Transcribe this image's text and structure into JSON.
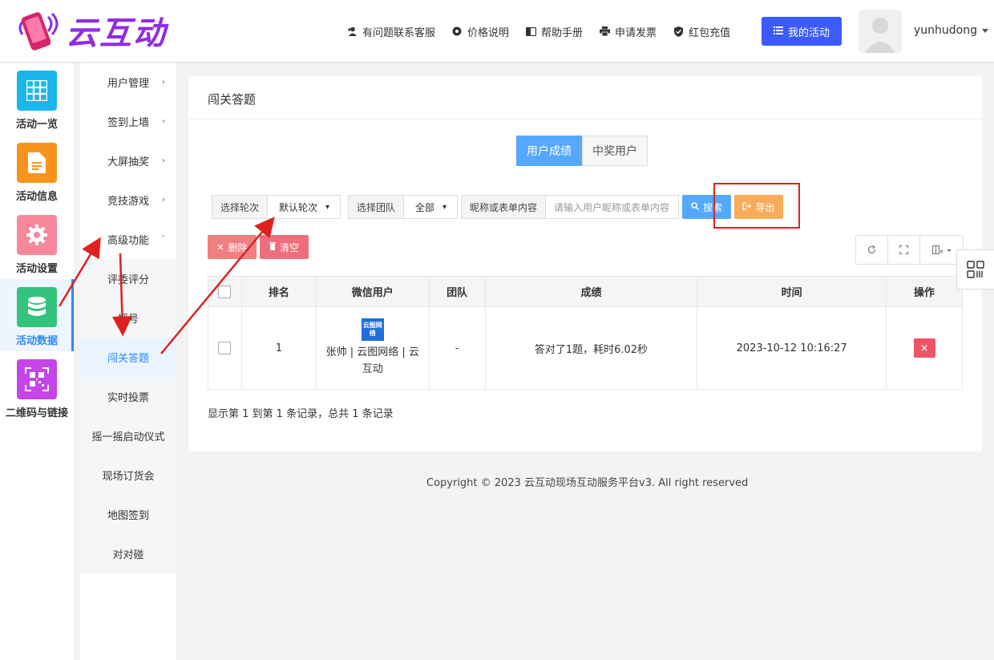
{
  "brand": {
    "name": "云互动"
  },
  "header": {
    "nav": [
      {
        "label": "有问题联系客服",
        "icon": "user-plus-icon"
      },
      {
        "label": "价格说明",
        "icon": "gear-icon"
      },
      {
        "label": "帮助手册",
        "icon": "book-icon"
      },
      {
        "label": "申请发票",
        "icon": "printer-icon"
      },
      {
        "label": "红包充值",
        "icon": "shield-check-icon"
      }
    ],
    "my_activity": "我的活动",
    "username": "yunhudong"
  },
  "rail": [
    {
      "label": "活动一览",
      "icon": "grid-icon",
      "color": "#1ab7ea"
    },
    {
      "label": "活动信息",
      "icon": "document-icon",
      "color": "#f7941d"
    },
    {
      "label": "活动设置",
      "icon": "gear-icon",
      "color": "#f7889a"
    },
    {
      "label": "活动数据",
      "icon": "database-icon",
      "color": "#33c37d"
    },
    {
      "label": "二维码与链接",
      "icon": "qrcode-icon",
      "color": "#c545e9"
    }
  ],
  "submenu": [
    "用户管理",
    "签到上墙",
    "大屏抽奖",
    "竞技游戏",
    "高级功能",
    "评委评分",
    "摇号",
    "闯关答题",
    "实时投票",
    "摇一摇启动仪式",
    "现场订货会",
    "地图签到",
    "对对碰"
  ],
  "panel": {
    "title": "闯关答题",
    "tabs": [
      "用户成绩",
      "中奖用户"
    ]
  },
  "filters": {
    "round_label": "选择轮次",
    "round_value": "默认轮次",
    "team_label": "选择团队",
    "team_value": "全部",
    "keyword_label": "昵称或表单内容",
    "keyword_placeholder": "请输入用户昵称或表单内容"
  },
  "buttons": {
    "search": "搜索",
    "export": "导出",
    "delete": "删除",
    "clear": "清空"
  },
  "table": {
    "headers": [
      "排名",
      "微信用户",
      "团队",
      "成绩",
      "时间",
      "操作"
    ],
    "rows": [
      {
        "rank": "1",
        "logo_text": "云图网络",
        "user": "张帅 | 云图网络 | 云互动",
        "team": "-",
        "score": "答对了1题，耗时6.02秒",
        "time": "2023-10-12 10:16:27",
        "action": "×"
      }
    ],
    "summary": "显示第 1 到第 1 条记录，总共 1 条记录"
  },
  "footer": {
    "copyright": "Copyright © 2023 云互动现场互动服务平台v3. All right reserved"
  },
  "colors": {
    "accent": "#55a8fd",
    "primary": "#3b5bfd",
    "warning": "#f8ac59",
    "danger": "#ed5565",
    "annotation": "#e02020"
  }
}
